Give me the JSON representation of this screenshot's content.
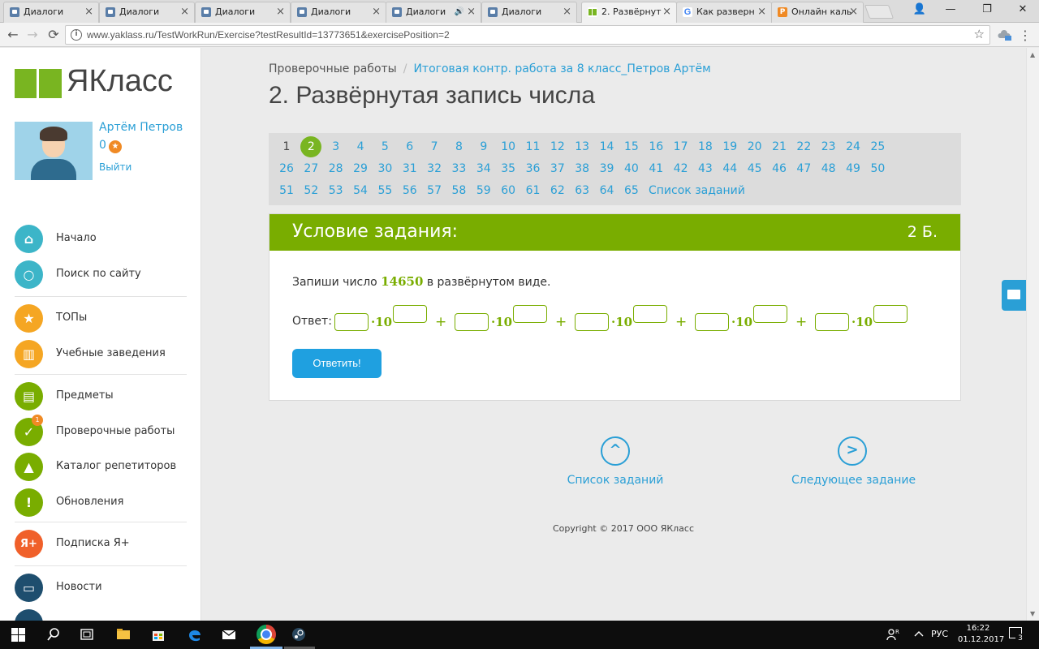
{
  "browser": {
    "tabs": [
      {
        "label": "Диалоги",
        "icon": "dialog-icon"
      },
      {
        "label": "Диалоги",
        "icon": "dialog-icon"
      },
      {
        "label": "Диалоги",
        "icon": "dialog-icon"
      },
      {
        "label": "Диалоги",
        "icon": "dialog-icon"
      },
      {
        "label": "Диалоги",
        "icon": "dialog-icon",
        "audio": "🔊"
      },
      {
        "label": "Диалоги",
        "icon": "dialog-icon"
      },
      {
        "label": "2. Развёрнут",
        "icon": "yaklass-icon",
        "active": true
      },
      {
        "label": "Как разверн",
        "icon": "google-icon",
        "icon_text": "G"
      },
      {
        "label": "Онлайн каль",
        "icon": "calculator-icon",
        "icon_text": "P"
      }
    ],
    "tab_close": "×",
    "url": "www.yaklass.ru/TestWorkRun/Exercise?testResultId=13773651&exercisePosition=2",
    "window_controls": {
      "minimize": "—",
      "maximize": "❐",
      "close": "✕",
      "profile": "👤"
    },
    "nav": {
      "back": "←",
      "forward": "→",
      "reload": "⟳"
    },
    "info_icon": "i",
    "star_icon": "☆",
    "menu_icon": "⋮"
  },
  "sidebar": {
    "logo_text": "ЯКласс",
    "user": {
      "name": "Артём Петров",
      "points": "0",
      "points_icon": "★",
      "logout": "Выйти"
    },
    "groups": [
      [
        {
          "label": "Начало",
          "icon": "home-icon",
          "glyph": "⌂",
          "color": "#3cb5c8"
        },
        {
          "label": "Поиск по сайту",
          "icon": "search-icon",
          "glyph": "○",
          "color": "#3cb5c8"
        }
      ],
      [
        {
          "label": "ТОПы",
          "icon": "star-icon",
          "glyph": "★",
          "color": "#f5a623"
        },
        {
          "label": "Учебные заведения",
          "icon": "school-icon",
          "glyph": "▥",
          "color": "#f5a623"
        }
      ],
      [
        {
          "label": "Предметы",
          "icon": "book-icon",
          "glyph": "▤",
          "color": "#79ad00"
        },
        {
          "label": "Проверочные работы",
          "icon": "checkmark-icon",
          "glyph": "✓",
          "color": "#79ad00",
          "badge": "1"
        },
        {
          "label": "Каталог репетиторов",
          "icon": "graduation-cap-icon",
          "glyph": "▲",
          "color": "#79ad00"
        },
        {
          "label": "Обновления",
          "icon": "exclamation-icon",
          "glyph": "!",
          "color": "#79ad00"
        }
      ],
      [
        {
          "label": "Подписка Я+",
          "icon": "subscription-icon",
          "glyph": "Я+",
          "color": "#f0602a"
        }
      ],
      [
        {
          "label": "Новости",
          "icon": "news-icon",
          "glyph": "▭",
          "color": "#1e4e6e"
        }
      ]
    ]
  },
  "breadcrumb": {
    "first": "Проверочные работы",
    "separator": "/",
    "second": "Итоговая контр. работа за 8 класс_Петров Артём"
  },
  "title": "2. Развёрнутая запись числа",
  "task_nav": {
    "rows": [
      [
        "1",
        "2",
        "3",
        "4",
        "5",
        "6",
        "7",
        "8",
        "9",
        "10",
        "11",
        "12",
        "13",
        "14",
        "15",
        "16",
        "17",
        "18",
        "19",
        "20",
        "21",
        "22",
        "23",
        "24",
        "25"
      ],
      [
        "26",
        "27",
        "28",
        "29",
        "30",
        "31",
        "32",
        "33",
        "34",
        "35",
        "36",
        "37",
        "38",
        "39",
        "40",
        "41",
        "42",
        "43",
        "44",
        "45",
        "46",
        "47",
        "48",
        "49",
        "50"
      ],
      [
        "51",
        "52",
        "53",
        "54",
        "55",
        "56",
        "57",
        "58",
        "59",
        "60",
        "61",
        "62",
        "63",
        "64",
        "65"
      ]
    ],
    "done": "1",
    "current": "2",
    "task_list_link": "Список заданий"
  },
  "task": {
    "header": "Условие задания:",
    "points": "2 Б.",
    "question_before": "Запиши число",
    "number": "14650",
    "question_after": "в развёрнутом виде.",
    "answer_label": "Ответ:",
    "base": "·10",
    "plus": "+",
    "terms": 5,
    "submit": "Ответить!"
  },
  "bottom_nav": {
    "list": {
      "label": "Список заданий",
      "icon": "chevron-up-icon",
      "glyph": "^"
    },
    "next": {
      "label": "Следующее задание",
      "icon": "chevron-right-icon",
      "glyph": ">"
    }
  },
  "copyright": "Copyright © 2017 ООО ЯКласс",
  "taskbar": {
    "language": "РУС",
    "time": "16:22",
    "date": "01.12.2017",
    "notifications": "3"
  }
}
